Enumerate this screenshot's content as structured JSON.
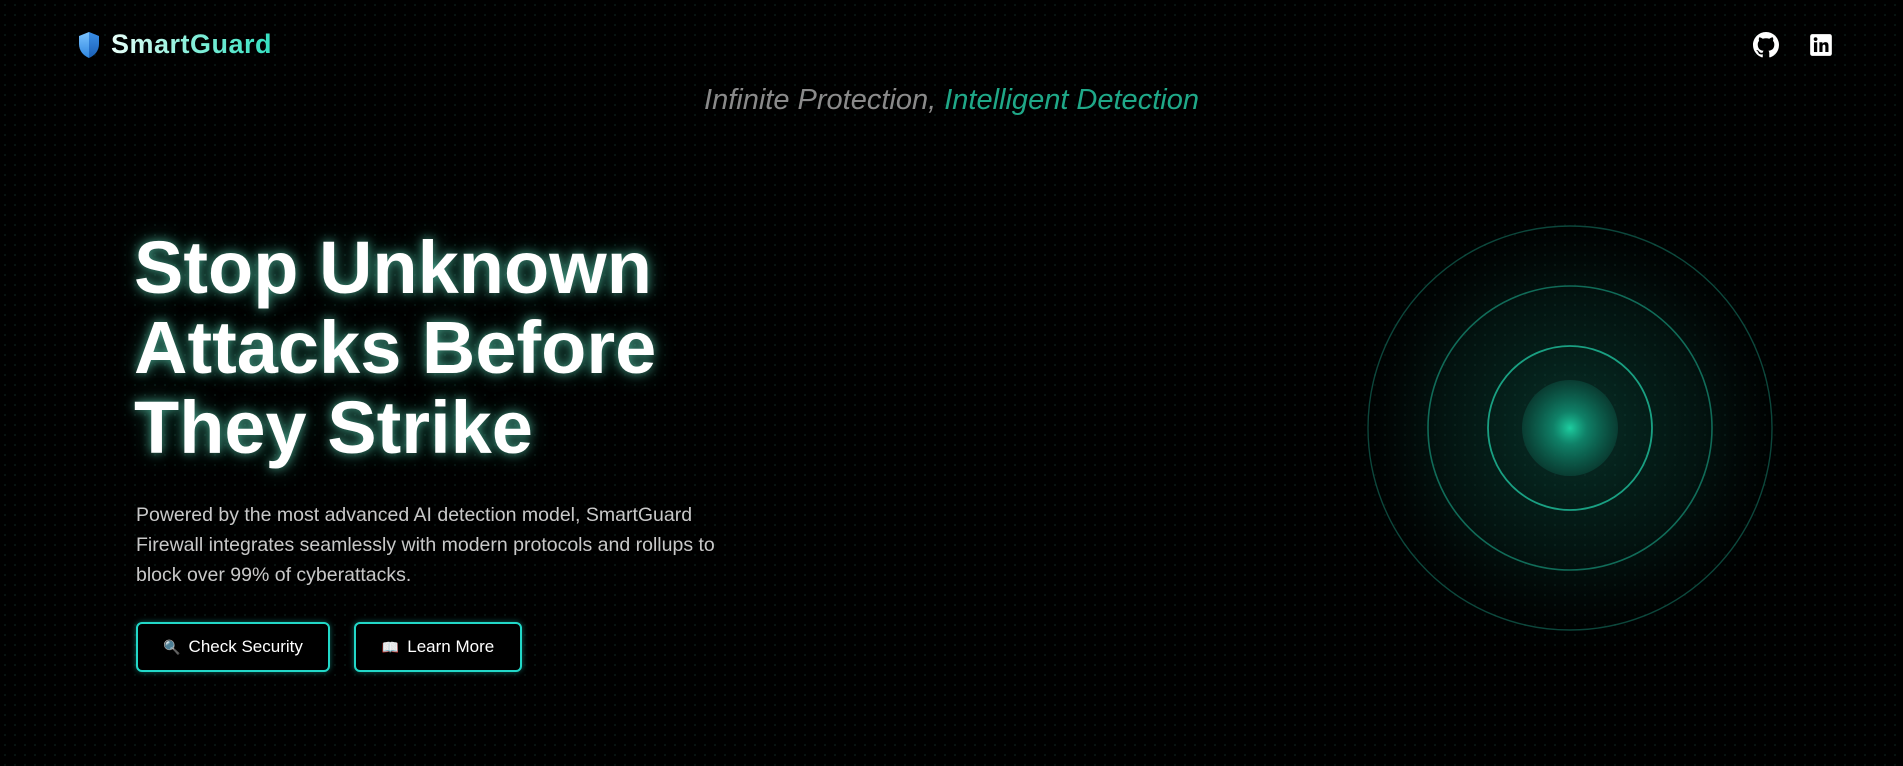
{
  "header": {
    "brand_name": "SmartGuard",
    "social": [
      {
        "name": "github",
        "icon": "github-icon"
      },
      {
        "name": "linkedin",
        "icon": "linkedin-icon"
      }
    ]
  },
  "tagline": {
    "lead": "Infinite Protection, ",
    "accent": "Intelligent Detection"
  },
  "hero": {
    "title_lines": [
      "Stop Unknown",
      "Attacks Before",
      "They Strike"
    ],
    "description": "Powered by the most advanced AI detection model, SmartGuard Firewall integrates seamlessly with modern protocols and rollups to block over 99% of cyberattacks.",
    "buttons": [
      {
        "label": "Check Security",
        "icon": "🔍",
        "icon_name": "magnifier-icon"
      },
      {
        "label": "Learn More",
        "icon": "📖",
        "icon_name": "book-icon"
      }
    ]
  },
  "colors": {
    "background": "#000000",
    "accent": "#22d8c8",
    "tagline_accent": "#1fa888",
    "radar": "#1fb894"
  }
}
